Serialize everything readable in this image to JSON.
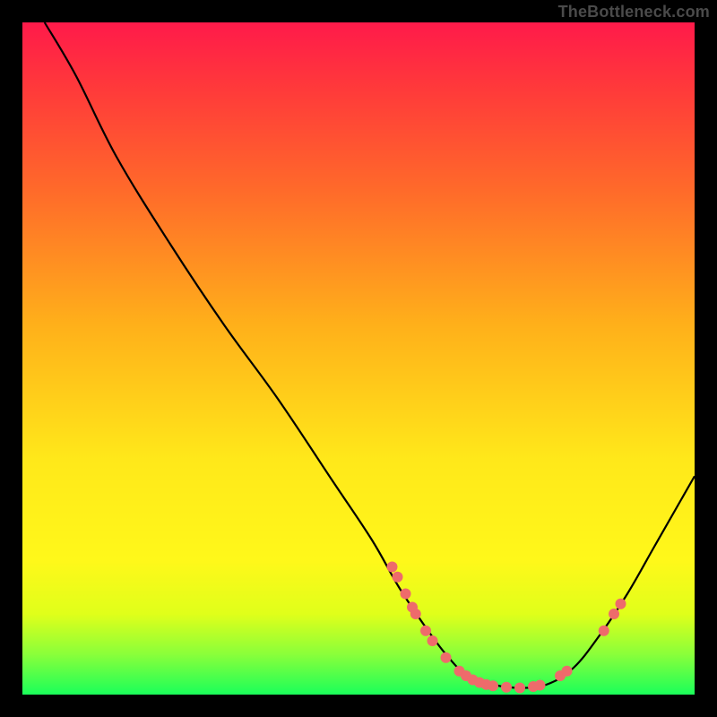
{
  "attribution": "TheBottleneck.com",
  "chart_data": {
    "type": "line",
    "title": "",
    "xlabel": "",
    "ylabel": "",
    "xlim": [
      0,
      100
    ],
    "ylim": [
      0,
      100
    ],
    "curve": [
      {
        "x": 3.3,
        "y": 100
      },
      {
        "x": 8,
        "y": 92
      },
      {
        "x": 14,
        "y": 80
      },
      {
        "x": 22,
        "y": 67
      },
      {
        "x": 30,
        "y": 55
      },
      {
        "x": 38,
        "y": 44
      },
      {
        "x": 46,
        "y": 32
      },
      {
        "x": 52,
        "y": 23
      },
      {
        "x": 56,
        "y": 16
      },
      {
        "x": 60,
        "y": 10
      },
      {
        "x": 63,
        "y": 6
      },
      {
        "x": 66,
        "y": 3
      },
      {
        "x": 70,
        "y": 1.5
      },
      {
        "x": 74,
        "y": 1
      },
      {
        "x": 78,
        "y": 1.5
      },
      {
        "x": 82,
        "y": 4
      },
      {
        "x": 86,
        "y": 9
      },
      {
        "x": 90,
        "y": 15
      },
      {
        "x": 94,
        "y": 22
      },
      {
        "x": 98,
        "y": 29
      },
      {
        "x": 100,
        "y": 32.5
      }
    ],
    "markers": [
      {
        "x": 55,
        "y": 19
      },
      {
        "x": 55.8,
        "y": 17.5
      },
      {
        "x": 57,
        "y": 15
      },
      {
        "x": 58,
        "y": 13
      },
      {
        "x": 58.5,
        "y": 12
      },
      {
        "x": 60,
        "y": 9.5
      },
      {
        "x": 61,
        "y": 8
      },
      {
        "x": 63,
        "y": 5.5
      },
      {
        "x": 65,
        "y": 3.5
      },
      {
        "x": 66,
        "y": 2.8
      },
      {
        "x": 67,
        "y": 2.2
      },
      {
        "x": 68,
        "y": 1.8
      },
      {
        "x": 69,
        "y": 1.5
      },
      {
        "x": 70,
        "y": 1.3
      },
      {
        "x": 72,
        "y": 1.1
      },
      {
        "x": 74,
        "y": 1
      },
      {
        "x": 76,
        "y": 1.2
      },
      {
        "x": 77,
        "y": 1.4
      },
      {
        "x": 80,
        "y": 2.8
      },
      {
        "x": 81,
        "y": 3.5
      },
      {
        "x": 86.5,
        "y": 9.5
      },
      {
        "x": 88,
        "y": 12
      },
      {
        "x": 89,
        "y": 13.5
      }
    ],
    "marker_color": "#ee6b6b",
    "line_color": "#000000"
  },
  "frame": {
    "inner_left": 25,
    "inner_top": 25,
    "inner_w": 750,
    "inner_h": 750
  }
}
